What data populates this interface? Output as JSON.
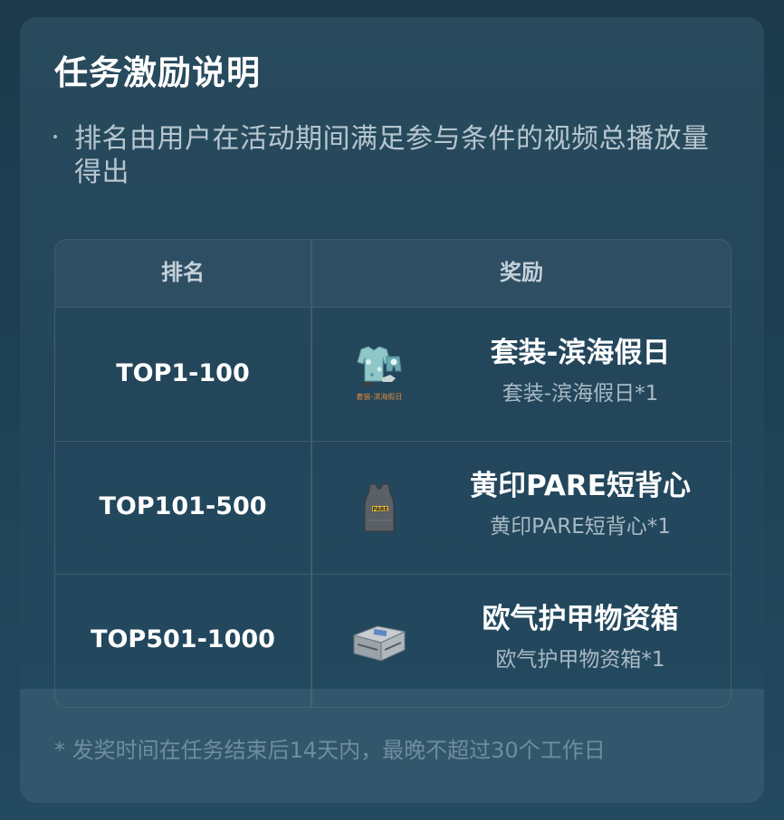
{
  "section": {
    "title": "任务激励说明",
    "description": "排名由用户在活动期间满足参与条件的视频总播放量得出"
  },
  "table": {
    "headers": {
      "rank": "排名",
      "reward": "奖励"
    },
    "rows": [
      {
        "rank": "TOP1-100",
        "reward_name": "套装-滨海假日",
        "reward_detail": "套装-滨海假日*1",
        "icon": "outfit-icon",
        "icon_caption": "套装-滨海假日"
      },
      {
        "rank": "TOP101-500",
        "reward_name": "黄印PARE短背心",
        "reward_detail": "黄印PARE短背心*1",
        "icon": "vest-icon",
        "icon_caption": "PARE"
      },
      {
        "rank": "TOP501-1000",
        "reward_name": "欧气护甲物资箱",
        "reward_detail": "欧气护甲物资箱*1",
        "icon": "supply-crate-icon"
      }
    ]
  },
  "footnote": "* 发奖时间在任务结束后14天内，最晚不超过30个工作日",
  "colors": {
    "background": "#1e4054",
    "card": "#264a5e",
    "border": "#3d5e72",
    "text_primary": "#ffffff",
    "text_secondary": "#a9bac4",
    "text_muted": "#6e8d9e"
  }
}
